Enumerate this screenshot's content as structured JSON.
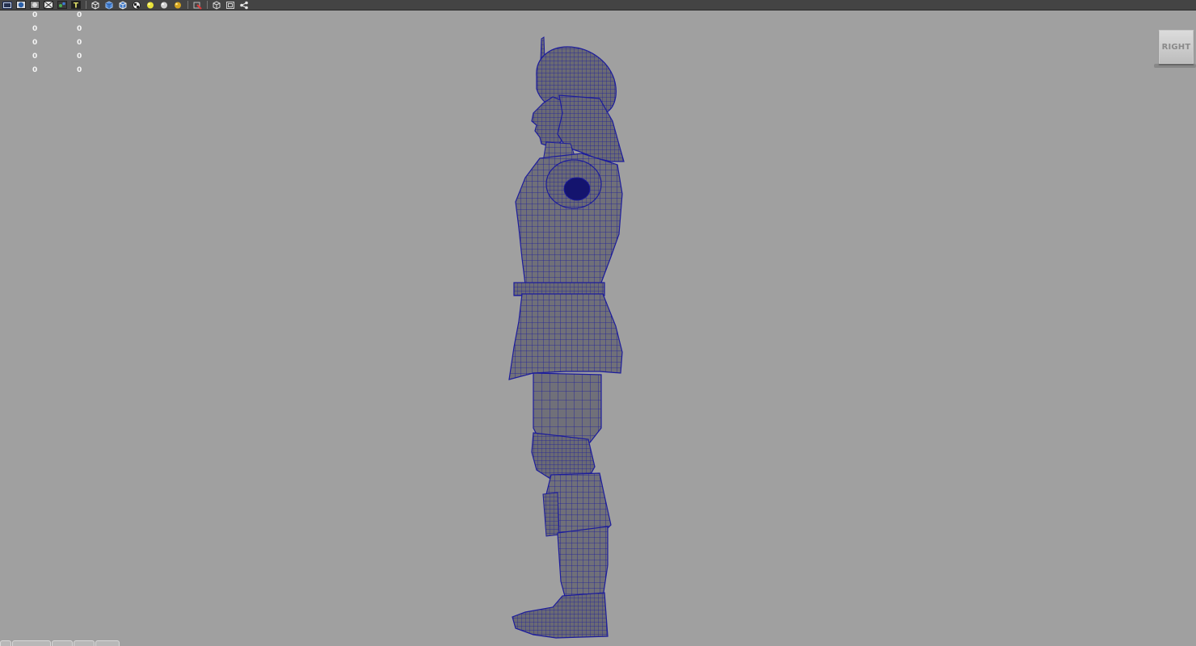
{
  "viewport": {
    "background": "#a0a0a0",
    "camera_label": "RIGHT"
  },
  "toolbar": {
    "background": "#444444",
    "icons": [
      "film-gate-icon",
      "camera-sphere-icon",
      "resolution-gate-icon",
      "grid-icon",
      "safe-frame-icon",
      "text-icon",
      "wireframe-cube-icon",
      "smooth-shade-icon",
      "shaded-wireframe-icon",
      "checker-texture-icon",
      "default-light-icon",
      "all-lights-icon",
      "shadows-icon",
      "isolate-select-icon",
      "bounding-box-icon",
      "xray-icon",
      "share-icon"
    ]
  },
  "hud": {
    "rows": [
      {
        "c1": "0",
        "c2": "0"
      },
      {
        "c1": "0",
        "c2": "0"
      },
      {
        "c1": "0",
        "c2": "0"
      },
      {
        "c1": "0",
        "c2": "0"
      },
      {
        "c1": "0",
        "c2": "0"
      }
    ]
  },
  "model": {
    "name": "character-mesh",
    "wire_color": "#1c1c9c",
    "fill_color": "#6e6e78"
  }
}
